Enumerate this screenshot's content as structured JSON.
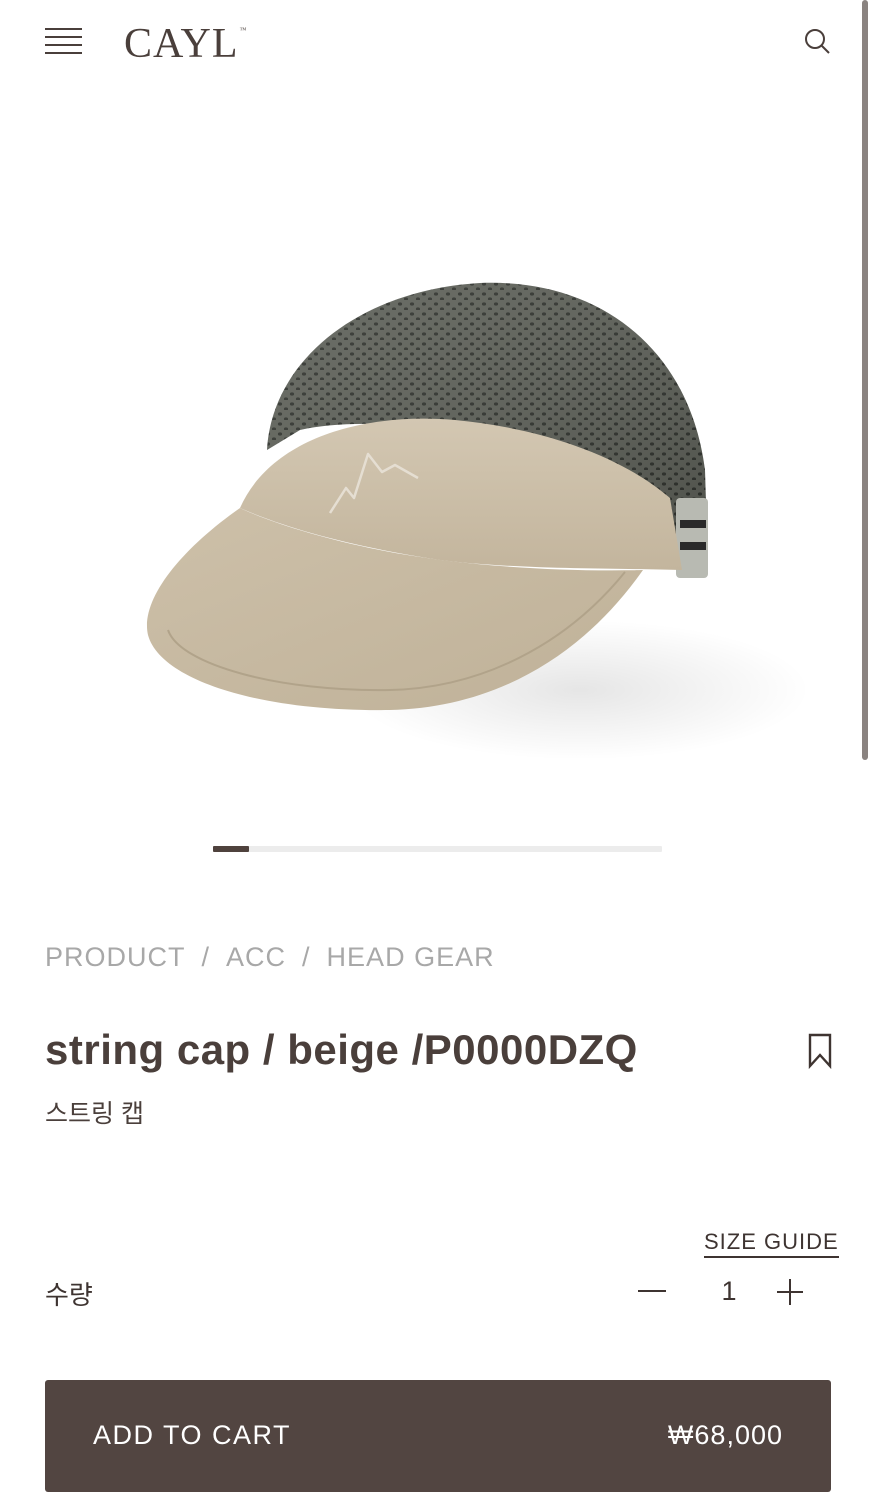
{
  "header": {
    "logo": "CAYL",
    "logo_mark": "™",
    "menu_icon": "hamburger-menu-icon",
    "search_icon": "search-icon"
  },
  "gallery": {
    "image_alt": "beige string cap with gray mesh crown",
    "progress": 0.08,
    "colors": {
      "mesh": "#5d6058",
      "beige": "#c9bca6",
      "indicator": "#4f423d"
    }
  },
  "breadcrumb": {
    "items": [
      "PRODUCT",
      "ACC",
      "HEAD GEAR"
    ],
    "separator": "/"
  },
  "product": {
    "title": "string cap / beige /P0000DZQ",
    "subtitle": "스트링 캡",
    "bookmark_icon": "bookmark-icon"
  },
  "size_guide": "SIZE GUIDE",
  "quantity": {
    "label": "수량",
    "value": "1",
    "minus_icon": "minus-icon",
    "plus_icon": "plus-icon"
  },
  "cart": {
    "label": "ADD TO CART",
    "price": "₩68,000",
    "background": "#524541"
  }
}
